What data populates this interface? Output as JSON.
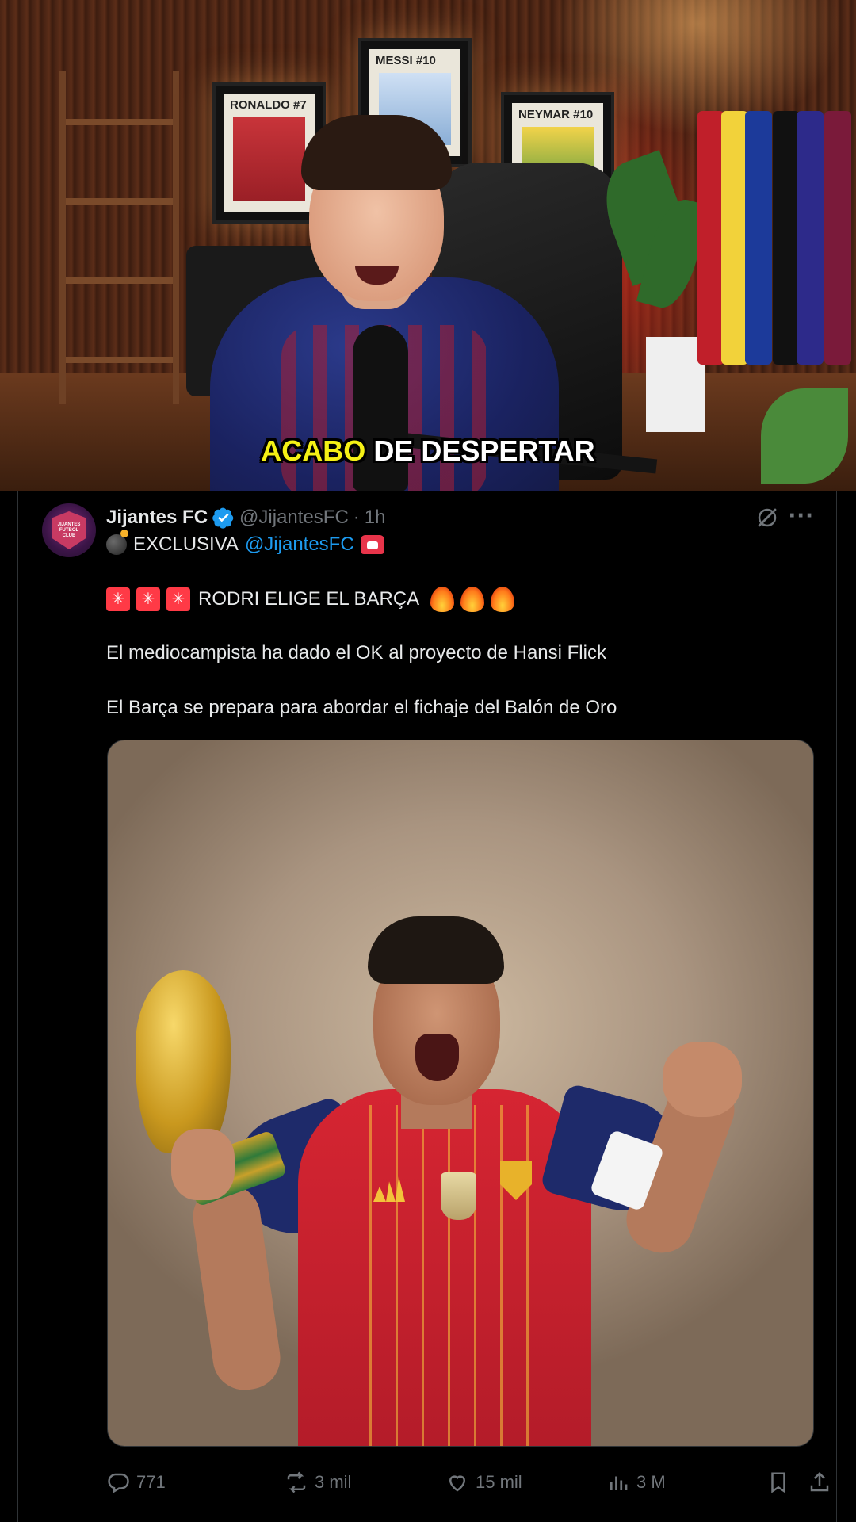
{
  "video": {
    "caption_highlight": "ACABO",
    "caption_rest": "DE DESPERTAR",
    "posters": [
      {
        "label": "RONALDO #7"
      },
      {
        "label": "MESSI #10"
      },
      {
        "label": "NEYMAR #10"
      }
    ]
  },
  "tweet": {
    "display_name": "Jijantes FC",
    "handle": "@JijantesFC",
    "separator": "·",
    "time": "1h",
    "line1_text": "EXCLUSIVA",
    "line1_mention": "@JijantesFC",
    "headline": "RODRI ELIGE EL BARÇA",
    "paragraph1": "El mediocampista ha dado el OK al proyecto de Hansi Flick",
    "paragraph2": "El Barça se prepara para abordar el fichaje del Balón de Oro",
    "avatar_text": "JIJANTES FUTBOL CLUB",
    "actions": {
      "replies": "771",
      "reposts": "3 mil",
      "likes": "15 mil",
      "views": "3 M"
    }
  },
  "icons": {
    "verified": "verified-badge-icon",
    "grok": "grok-icon",
    "more": "more-icon",
    "reply": "reply-icon",
    "repost": "repost-icon",
    "like": "heart-icon",
    "views": "views-icon",
    "bookmark": "bookmark-icon",
    "share": "share-icon"
  },
  "colors": {
    "caption_highlight": "#f5f015",
    "mention": "#1d9bf0",
    "muted": "#71767b",
    "verified": "#1d9bf0",
    "background": "#000000"
  }
}
